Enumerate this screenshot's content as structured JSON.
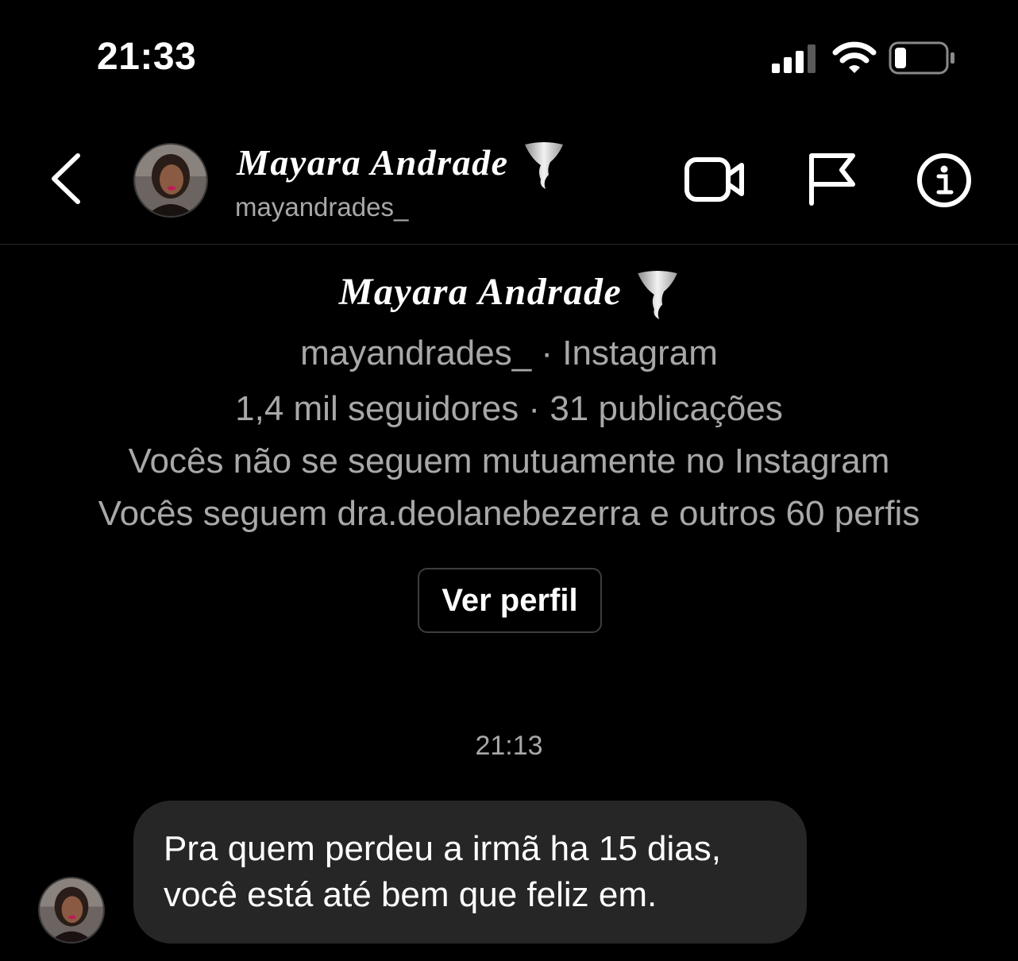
{
  "status_bar": {
    "time": "21:33",
    "icons": [
      "cellular-signal-icon",
      "wifi-icon",
      "battery-icon"
    ]
  },
  "header": {
    "back_icon": "chevron-left-icon",
    "display_name": "Mayara Andrade",
    "name_emoji": "tornado-icon",
    "username": "mayandrades_",
    "actions": [
      "video-camera-icon",
      "flag-icon",
      "info-icon"
    ]
  },
  "profile_card": {
    "name": "Mayara Andrade",
    "source": "mayandrades_ · Instagram",
    "stats": "1,4 mil seguidores · 31 publicações",
    "mutual_status": "Vocês não se seguem mutuamente no Instagram",
    "following_info": "Vocês seguem dra.deolanebezerra e outros 60 perfis",
    "view_profile_label": "Ver perfil"
  },
  "conversation": {
    "timestamp": "21:13",
    "messages": [
      {
        "sender": "Mayara Andrade",
        "text": "Pra quem perdeu a irmã ha 15 dias,\nvocê está até bem que feliz em."
      }
    ]
  },
  "colors": {
    "background": "#000000",
    "text_primary": "#ffffff",
    "text_secondary": "#a8a8a8",
    "bubble_incoming": "#262626",
    "divider": "#262626"
  }
}
